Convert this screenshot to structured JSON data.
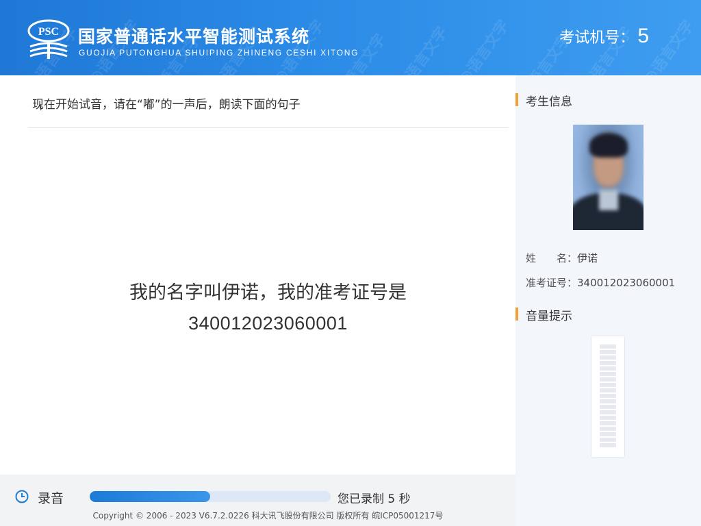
{
  "header": {
    "logo_text": "PSC",
    "title_cn": "国家普通话水平智能测试系统",
    "title_en": "GUOJIA PUTONGHUA SHUIPING ZHINENG CESHI XITONG",
    "exam_no_label": "考试机号：",
    "exam_no_value": "5",
    "watermark_text": "@语言文字"
  },
  "main": {
    "instruction": "现在开始试音，请在“嘟”的一声后，朗读下面的句子",
    "reading_line1": "我的名字叫伊诺，我的准考证号是",
    "reading_line2": "340012023060001"
  },
  "sidebar": {
    "candidate_title": "考生信息",
    "name_label": "姓　　名：",
    "name_value": "伊诺",
    "ticket_label": "准考证号：",
    "ticket_value": "340012023060001",
    "volume_title": "音量提示",
    "volume_level": 0
  },
  "bottom": {
    "record_label": "录音",
    "progress": 0.5,
    "record_status": "您已录制 5 秒",
    "copyright": "Copyright © 2006 - 2023 V6.7.2.0226 科大讯飞股份有限公司 版权所有 皖ICP05001217号"
  },
  "colors": {
    "header_blue": "#2b8be6",
    "accent_orange": "#f0a036",
    "progress_blue": "#1c7bd6"
  },
  "icons": {
    "logo": "psc-logo-icon",
    "record": "clock-icon",
    "cursor": "text-cursor-icon"
  }
}
